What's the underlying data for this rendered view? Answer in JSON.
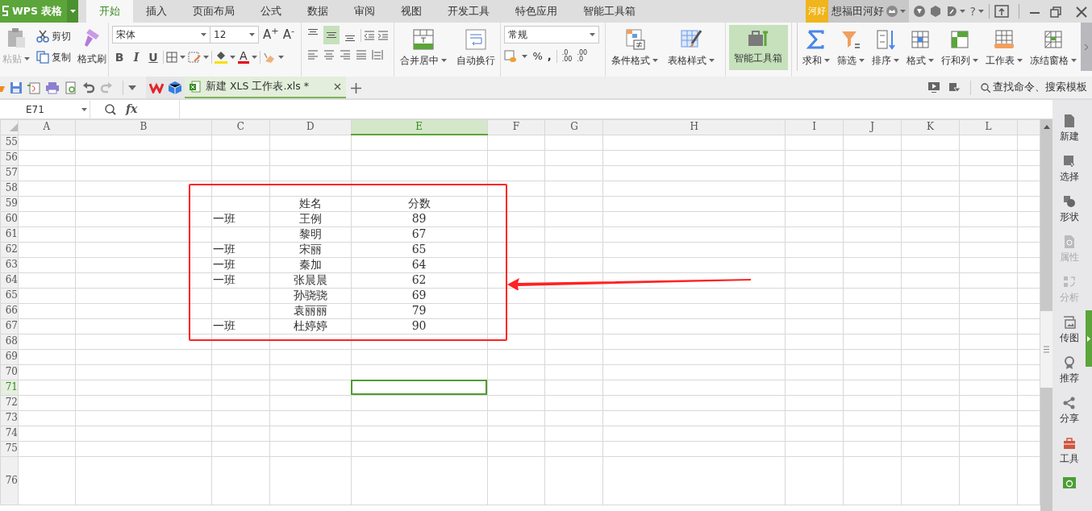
{
  "app": {
    "title": "WPS 表格"
  },
  "menu_tabs": [
    {
      "label": "开始",
      "selected": true
    },
    {
      "label": "插入",
      "selected": false
    },
    {
      "label": "页面布局",
      "selected": false
    },
    {
      "label": "公式",
      "selected": false
    },
    {
      "label": "数据",
      "selected": false
    },
    {
      "label": "审阅",
      "selected": false
    },
    {
      "label": "视图",
      "selected": false
    },
    {
      "label": "开发工具",
      "selected": false
    },
    {
      "label": "特色应用",
      "selected": false
    },
    {
      "label": "智能工具箱",
      "selected": false
    }
  ],
  "account": {
    "badge": "河好",
    "user_name": "想福田河好",
    "help_label": "?"
  },
  "ribbon": {
    "clipboard": {
      "paste": {
        "label": "粘贴",
        "disabled": true
      },
      "small_buttons": [
        "剪切",
        "复制"
      ],
      "format_painter": "格式刷"
    },
    "font": {
      "name": "宋体",
      "size": "12",
      "size_buttons": [
        "A$^{+}$",
        "A$^{-}$"
      ],
      "style_buttons": [
        "B",
        "I",
        "U"
      ],
      "font_color_label": "A"
    },
    "vertical_align": [
      {
        "selected": false
      },
      {
        "selected": true
      },
      {
        "selected": false
      }
    ],
    "merge_buttons": [
      {
        "label": "合并居中",
        "dropdown": true
      },
      {
        "label": "自动换行",
        "dropdown": false
      }
    ],
    "number": {
      "format": "常规",
      "symbols": [
        "%",
        ","
      ],
      "decimal_buttons": [
        {
          "top": ".0",
          "bottom": ".00"
        },
        {
          "top": ".00",
          "bottom": ".0"
        }
      ]
    },
    "style_buttons": [
      {
        "label": "条件格式",
        "dropdown": true
      },
      {
        "label": "表格样式",
        "dropdown": true
      }
    ],
    "toolbox": {
      "label": "智能工具箱",
      "selected": true
    },
    "edit_buttons": [
      {
        "label": "求和",
        "dropdown": true
      },
      {
        "label": "筛选",
        "dropdown": true
      },
      {
        "label": "排序",
        "dropdown": true
      },
      {
        "label": "格式",
        "dropdown": true
      },
      {
        "label": "行和列",
        "dropdown": true
      },
      {
        "label": "工作表",
        "dropdown": true
      },
      {
        "label": "冻结窗格",
        "dropdown": true
      }
    ]
  },
  "document_tab": {
    "title": "新建 XLS 工作表.xls *",
    "selected": true
  },
  "search": {
    "placeholder": "查找命令、搜索模板"
  },
  "formula_bar": {
    "name_box": "E71",
    "function_label": "fx"
  },
  "sheet": {
    "columns": [
      {
        "label": "A",
        "selected": false
      },
      {
        "label": "B",
        "selected": false
      },
      {
        "label": "C",
        "selected": false
      },
      {
        "label": "D",
        "selected": false
      },
      {
        "label": "E",
        "selected": true
      },
      {
        "label": "F",
        "selected": false
      },
      {
        "label": "G",
        "selected": false
      },
      {
        "label": "H",
        "selected": false
      },
      {
        "label": "I",
        "selected": false
      },
      {
        "label": "J",
        "selected": false
      },
      {
        "label": "K",
        "selected": false
      },
      {
        "label": "L",
        "selected": false
      }
    ],
    "rows": [
      {
        "number": "55",
        "selected": false
      },
      {
        "number": "56",
        "selected": false
      },
      {
        "number": "57",
        "selected": false
      },
      {
        "number": "58",
        "selected": false
      },
      {
        "number": "59",
        "selected": false,
        "name": "姓名",
        "score": "分数"
      },
      {
        "number": "60",
        "selected": false,
        "class": "一班",
        "name": "王例",
        "score": "89"
      },
      {
        "number": "61",
        "selected": false,
        "name": "黎明",
        "score": "67"
      },
      {
        "number": "62",
        "selected": false,
        "class": "一班",
        "name": "宋丽",
        "score": "65"
      },
      {
        "number": "63",
        "selected": false,
        "class": "一班",
        "name": "秦加",
        "score": "64"
      },
      {
        "number": "64",
        "selected": false,
        "class": "一班",
        "name": "张晨晨",
        "score": "62"
      },
      {
        "number": "65",
        "selected": false,
        "name": "孙骁骁",
        "score": "69"
      },
      {
        "number": "66",
        "selected": false,
        "name": "袁丽丽",
        "score": "79"
      },
      {
        "number": "67",
        "selected": false,
        "class": "一班",
        "name": "杜婷婷",
        "score": "90"
      },
      {
        "number": "68",
        "selected": false
      },
      {
        "number": "69",
        "selected": false
      },
      {
        "number": "70",
        "selected": false
      },
      {
        "number": "71",
        "selected": true
      },
      {
        "number": "72",
        "selected": false
      },
      {
        "number": "73",
        "selected": false
      },
      {
        "number": "74",
        "selected": false
      },
      {
        "number": "75",
        "selected": false
      },
      {
        "number": "76",
        "selected": false
      }
    ]
  },
  "side_panel": [
    {
      "label": "新建",
      "disabled": false
    },
    {
      "label": "选择",
      "disabled": false
    },
    {
      "label": "形状",
      "disabled": false
    },
    {
      "label": "属性",
      "disabled": true
    },
    {
      "label": "分析",
      "disabled": true
    },
    {
      "label": "传图",
      "disabled": false
    },
    {
      "label": "推荐",
      "disabled": false
    },
    {
      "label": "分享",
      "disabled": false
    },
    {
      "label": "工具",
      "disabled": false
    }
  ]
}
